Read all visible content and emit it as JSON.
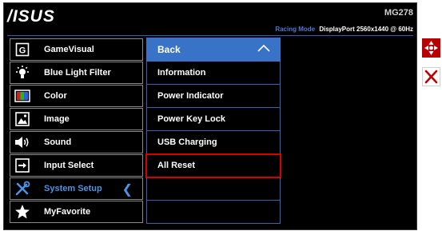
{
  "header": {
    "logo": "/ISUS",
    "model": "MG278",
    "mode_label": "Racing Mode",
    "input_info": "DisplayPort  2560x1440 @ 60Hz"
  },
  "main_menu": [
    {
      "label": "GameVisual",
      "icon": "gamevisual-icon"
    },
    {
      "label": "Blue Light Filter",
      "icon": "bulb-icon"
    },
    {
      "label": "Color",
      "icon": "color-icon"
    },
    {
      "label": "Image",
      "icon": "image-icon"
    },
    {
      "label": "Sound",
      "icon": "speaker-icon"
    },
    {
      "label": "Input Select",
      "icon": "input-icon"
    },
    {
      "label": "System Setup",
      "icon": "tools-icon",
      "active": true
    },
    {
      "label": "MyFavorite",
      "icon": "star-icon"
    }
  ],
  "submenu": {
    "back_label": "Back",
    "items": [
      "Information",
      "Power Indicator",
      "Power Key Lock",
      "USB Charging",
      "All Reset",
      "",
      ""
    ],
    "selected_index": 4
  },
  "colors": {
    "accent": "#3973c8",
    "active_text": "#4b93e5",
    "highlight": "#d60000"
  },
  "side_buttons": [
    "joystick-icon",
    "close-icon"
  ]
}
